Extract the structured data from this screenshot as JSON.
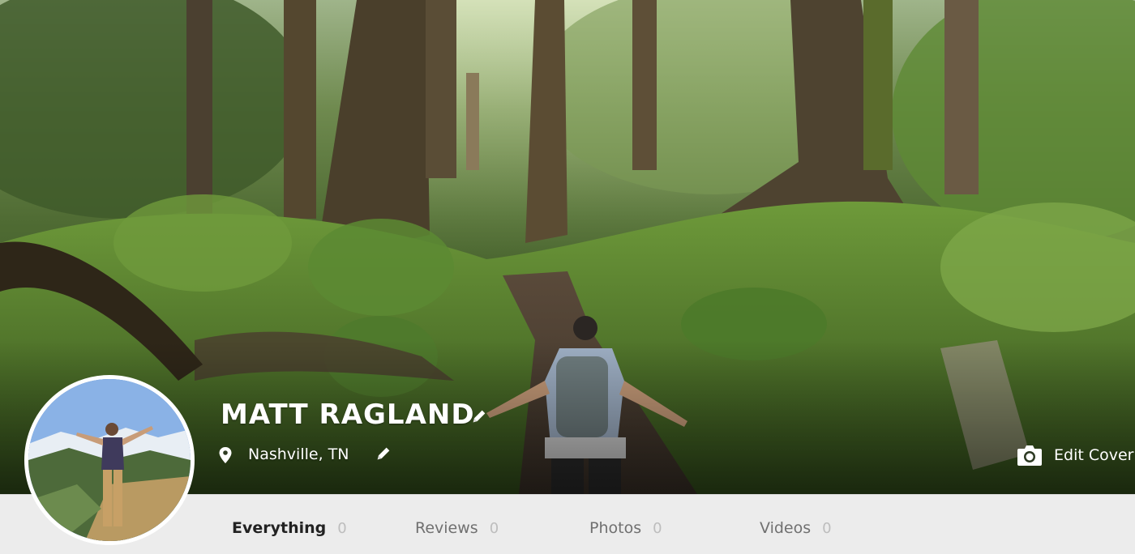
{
  "profile": {
    "name": "MATT RAGLAND",
    "location": "Nashville, TN"
  },
  "cover": {
    "edit_label": "Edit Cover"
  },
  "tabs": [
    {
      "label": "Everything",
      "count": "0",
      "active": true
    },
    {
      "label": "Reviews",
      "count": "0",
      "active": false
    },
    {
      "label": "Photos",
      "count": "0",
      "active": false
    },
    {
      "label": "Videos",
      "count": "0",
      "active": false
    }
  ],
  "icons": {
    "edit": "pencil-icon",
    "location": "map-pin-icon",
    "camera": "camera-icon"
  },
  "colors": {
    "tab_bar_bg": "#ececec",
    "active_tab_text": "#222222",
    "inactive_tab_text": "#707070",
    "count_text": "#bdbdbd",
    "overlay_text": "#ffffff"
  }
}
